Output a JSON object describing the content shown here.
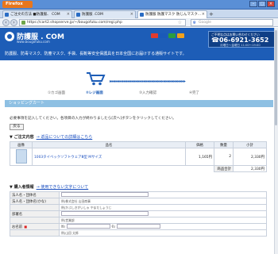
{
  "browser": {
    "app_button": "Firefox",
    "tabs": [
      {
        "label": "ご注文の方法 ■防護服、 COM"
      },
      {
        "label": "防護服 .COM"
      },
      {
        "label": "防護服 防護マスク 防じんマスク..."
      }
    ],
    "url": "https://cart2.shopserve.jp/~/bougofuku.com/regi.php",
    "search_placeholder": "Google"
  },
  "site": {
    "logo": "防護服 . COM",
    "logo_sub": "www.bougofuku.com",
    "tagline": "防護服、防毒マスク、防塵マスク、手袋、長靴等安全保護具を日本全国にお届けする通販サイトです。",
    "tel_label": "ご不明な点はお問い合わせください",
    "tel_number": "☎06-6921-3652",
    "tel_hours": "月曜日〜金曜日 11:00〜19:00",
    "card_colors": [
      "#e23b2e",
      "#1a59b8",
      "#2c9c3e",
      "#f3a11b"
    ]
  },
  "steps": {
    "items": [
      "①カゴ画面",
      "②レジ画面",
      "③入力確認",
      "④完了"
    ],
    "current": 1
  },
  "cart": {
    "section_title": "ショッピングカート",
    "note": "必要事項を記入してください。各項目の入力が終わりましたら[次へ]ボタンをクリックしてください。",
    "back_button": "戻る",
    "order_heading": "▼ ご注文内容",
    "order_link": "→ 返品についての詳細はこちら",
    "columns": [
      "画像",
      "品名",
      "価格",
      "数量",
      "小計"
    ],
    "rows": [
      {
        "name": "1003タイベックソフトウェアⅢ型 Mサイズ",
        "price": "1,165円",
        "qty": "2",
        "subtotal": "2,330円"
      }
    ],
    "total_label": "商品合計",
    "total_value": "2,330円"
  },
  "buyer": {
    "heading": "▼ 購入者情報",
    "heading_link": "→ 使用できない文字について",
    "fields": [
      {
        "label": "法人名・団体名",
        "value": "",
        "hint": ""
      },
      {
        "label": "法人名・団体名(かな)",
        "value": "",
        "hint": "例)株式会社 山田商事"
      },
      {
        "label": "",
        "value": "",
        "hint": "例)かぶしきがいしゃ やまだしょうじ"
      },
      {
        "label": "部署名",
        "value": "",
        "hint": ""
      },
      {
        "label": "",
        "value": "",
        "hint": "例)営業部"
      },
      {
        "label": "お名前",
        "value": "",
        "hint": "姓)",
        "hint2": "名)"
      },
      {
        "label": "",
        "value": "",
        "hint": "例)山田 太郎"
      }
    ]
  }
}
